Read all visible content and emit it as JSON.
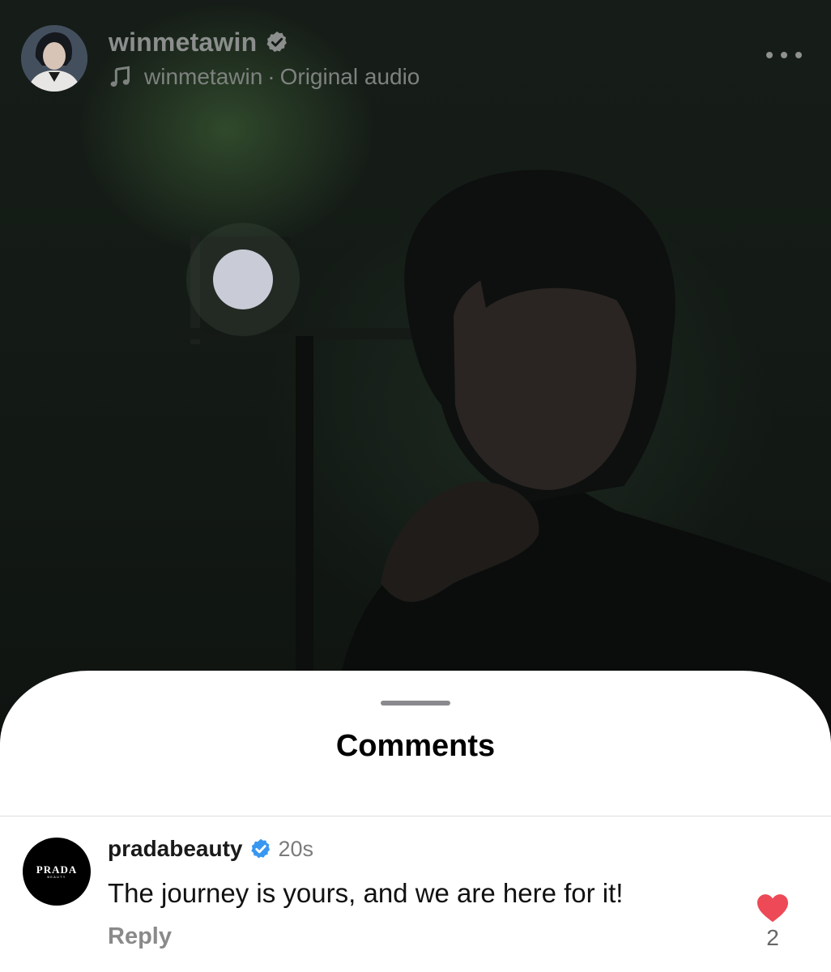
{
  "post": {
    "author": "winmetawin",
    "audio_owner": "winmetawin",
    "audio_separator": "·",
    "audio_title": "Original audio",
    "verified_icon": "verified-badge-icon",
    "more_icon": "more-options-icon",
    "music_icon": "music-note-icon"
  },
  "comments_sheet": {
    "title": "Comments",
    "items": [
      {
        "username": "pradabeauty",
        "verified": true,
        "time": "20s",
        "text": "The journey is yours, and we are here for it!",
        "reply_label": "Reply",
        "liked": true,
        "like_count": "2",
        "avatar_logo": "PRADA",
        "avatar_logo_sub": "BEAUTY"
      }
    ]
  },
  "colors": {
    "sheet_background": "#ffffff",
    "verified_blue": "#3897f0",
    "like_red": "#ed4956",
    "video_background": "#141b16"
  }
}
